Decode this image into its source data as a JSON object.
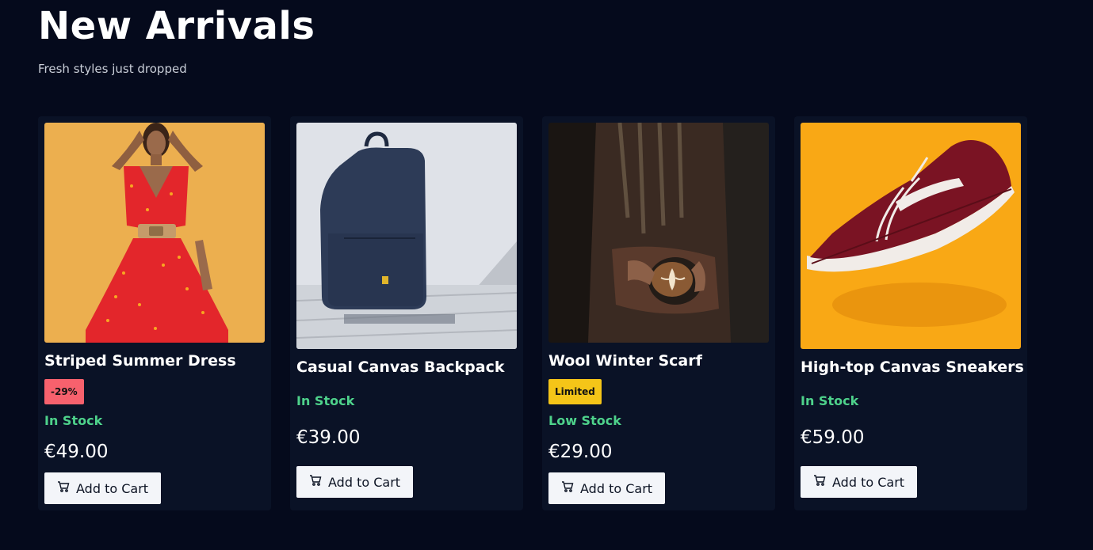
{
  "header": {
    "title": "New Arrivals",
    "subtitle": "Fresh styles just dropped"
  },
  "products": [
    {
      "name": "Striped Summer Dress",
      "badge": "-29%",
      "stock": "In Stock",
      "price": "€49.00",
      "button": "Add to Cart",
      "image_alt": "Woman in red floral dress"
    },
    {
      "name": "Casual Canvas Backpack",
      "stock": "In Stock",
      "price": "€39.00",
      "button": "Add to Cart",
      "image_alt": "Navy canvas backpack"
    },
    {
      "name": "Wool Winter Scarf",
      "badge": "Limited",
      "stock": "Low Stock",
      "price": "€29.00",
      "button": "Add to Cart",
      "image_alt": "Person wearing scarf holding coffee"
    },
    {
      "name": "High-top Canvas Sneakers",
      "stock": "In Stock",
      "price": "€59.00",
      "button": "Add to Cart",
      "image_alt": "Maroon canvas sneaker"
    }
  ],
  "colors": {
    "background": "#050a1c",
    "card": "#0a1226",
    "in_stock": "#4ed28b",
    "discount_badge": "#f7616d",
    "limited_badge": "#f5c518"
  },
  "icons": {
    "cart": "cart-icon"
  }
}
